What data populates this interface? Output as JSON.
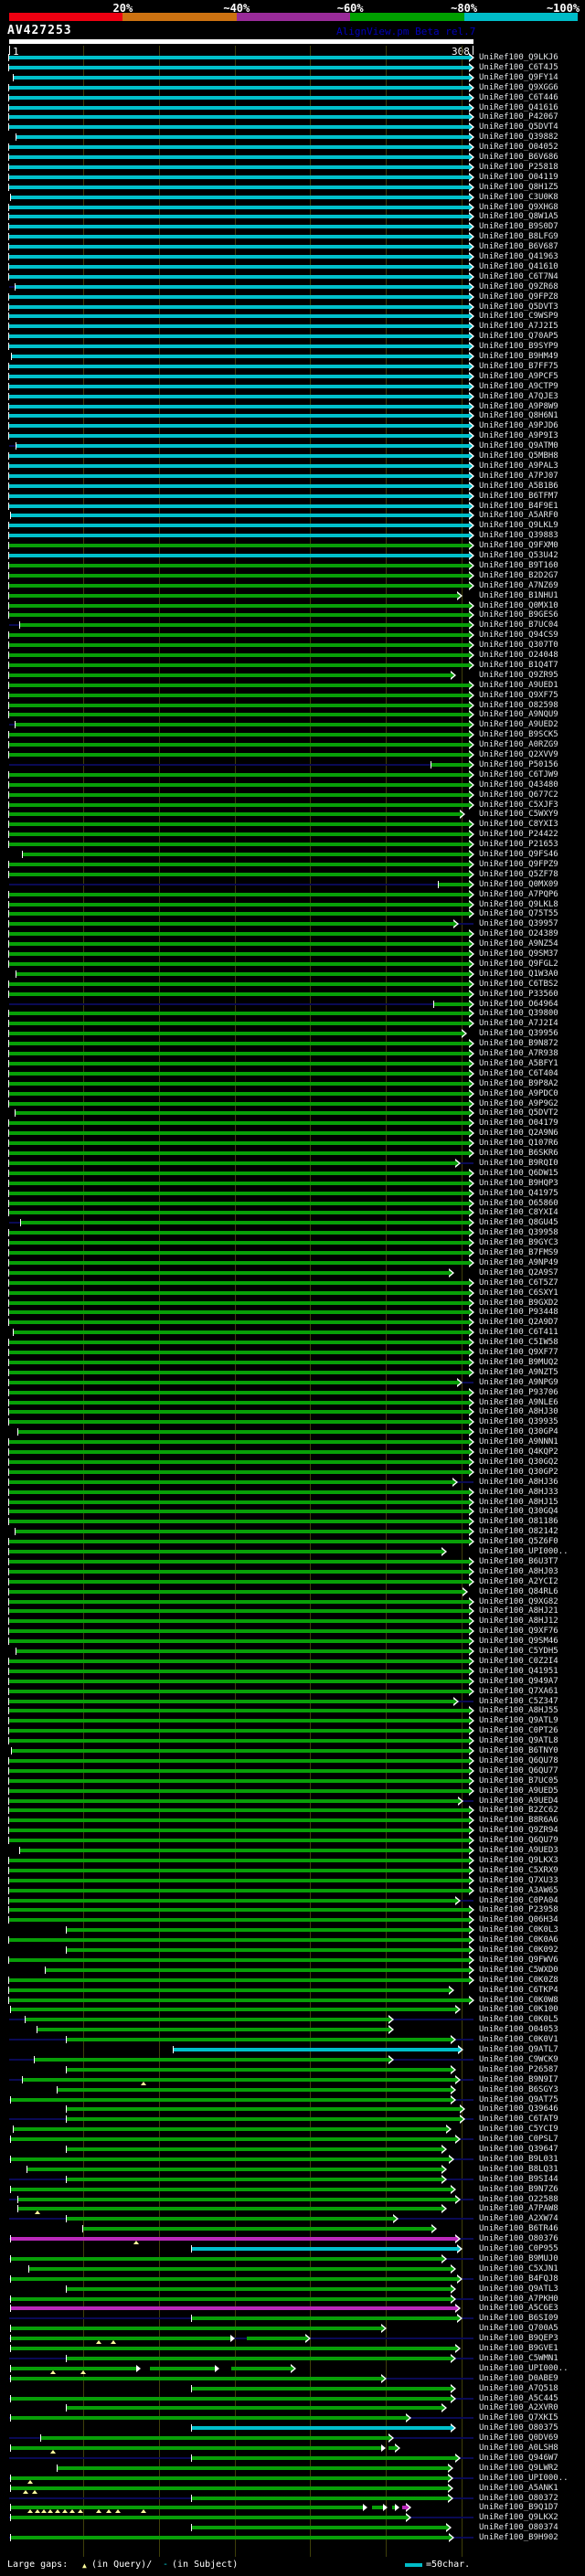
{
  "header": {
    "query_name": "AV427253",
    "tool_title": "AlignView.pm Beta rel.7"
  },
  "identity_key": {
    "labels": [
      "20%",
      "~40%",
      "~60%",
      "~80%",
      "~100%"
    ],
    "colors": [
      "#ee0011",
      "#cc7211",
      "#992b99",
      "#00a000",
      "#00bcc8"
    ]
  },
  "scale": {
    "start_label": "1",
    "end_label": "308",
    "query_length": 308,
    "tick_interval": 50
  },
  "colors": {
    "background": "#000000",
    "bar_cyan": "#00c0cb",
    "bar_green": "#089f08",
    "bar_magenta": "#bb29bb",
    "baseline_navy": "#0a0a55",
    "grid": "#3f3f0a",
    "gap_marker": "#ffff9c",
    "label_text": "#e2e6e9",
    "query_bar": "#ffffff",
    "tool_title_text": "#0000bb"
  },
  "legend": {
    "large_gaps_label": "Large gaps:",
    "in_query_label": "(in Query)/",
    "subject_dash": "-",
    "in_subject_label": " (in Subject)",
    "scale_note": "=50char."
  },
  "hit_prefix": "UniRef100_",
  "rows": [
    [
      "Q9LKJ6",
      "c",
      0
    ],
    [
      "C6T4J5",
      "c",
      0
    ],
    [
      "Q9FY14",
      "c",
      [
        [
          4,
          308
        ]
      ]
    ],
    [
      "Q9XGG6",
      "c",
      0
    ],
    [
      "C6T446",
      "c",
      0
    ],
    [
      "Q41616",
      "c",
      0
    ],
    [
      "P42067",
      "c",
      0
    ],
    [
      "Q5DVT4",
      "c",
      0
    ],
    [
      "Q39882",
      "c",
      [
        [
          6,
          308
        ]
      ]
    ],
    [
      "O04052",
      "c",
      0
    ],
    [
      "B6V686",
      "c",
      0
    ],
    [
      "P25818",
      "c",
      0
    ],
    [
      "O04119",
      "c",
      0
    ],
    [
      "Q8H1Z5",
      "c",
      0
    ],
    [
      "C3U0K8",
      "c",
      [
        [
          2,
          308
        ]
      ]
    ],
    [
      "Q9XHG8",
      "c",
      0
    ],
    [
      "Q8W1A5",
      "c",
      0
    ],
    [
      "B9S0D7",
      "c",
      0
    ],
    [
      "B8LFG9",
      "c",
      0
    ],
    [
      "B6V687",
      "c",
      0
    ],
    [
      "Q41963",
      "c",
      0
    ],
    [
      "Q41610",
      "c",
      0
    ],
    [
      "C6T7N4",
      "c",
      0
    ],
    [
      "Q9ZR68",
      "c",
      [
        [
          5,
          308
        ]
      ]
    ],
    [
      "Q9FPZ8",
      "c",
      0
    ],
    [
      "Q5DVT3",
      "c",
      0
    ],
    [
      "C9WSP9",
      "c",
      0
    ],
    [
      "A7J2I5",
      "c",
      0
    ],
    [
      "Q70AP5",
      "c",
      0
    ],
    [
      "B9SYP9",
      "c",
      0
    ],
    [
      "B9HM49",
      "c",
      [
        [
          3,
          308
        ]
      ]
    ],
    [
      "B7FF75",
      "c",
      0
    ],
    [
      "A9PCF5",
      "c",
      0
    ],
    [
      "A9CTP9",
      "c",
      0
    ],
    [
      "A7QJE3",
      "c",
      0
    ],
    [
      "A9P8W9",
      "c",
      0
    ],
    [
      "Q8H6N1",
      "c",
      0
    ],
    [
      "A9PJD6",
      "c",
      0
    ],
    [
      "A9P9I3",
      "c",
      0
    ],
    [
      "Q9ATM0",
      "c",
      [
        [
          6,
          308
        ]
      ]
    ],
    [
      "Q5MBH8",
      "c",
      0
    ],
    [
      "A9PAL3",
      "c",
      0
    ],
    [
      "A7PJ07",
      "c",
      0
    ],
    [
      "A5B1B6",
      "c",
      0
    ],
    [
      "B6TFM7",
      "c",
      0
    ],
    [
      "B4F9E1",
      "c",
      0
    ],
    [
      "A5ARF0",
      "c",
      [
        [
          2,
          308
        ]
      ]
    ],
    [
      "Q9LKL9",
      "c",
      0
    ],
    [
      "Q39883",
      "c",
      0
    ],
    [
      "Q9FXM0",
      "g",
      0
    ],
    [
      "Q53U42",
      "c",
      0
    ],
    [
      "B9T160",
      "g",
      0
    ],
    [
      "B2D2G7",
      "g",
      0
    ],
    [
      "A7NZ69",
      "g",
      0
    ],
    [
      "B1NHU1",
      "g",
      [
        [
          1,
          300
        ]
      ]
    ],
    [
      "Q0MX10",
      "g",
      0
    ],
    [
      "B9GES6",
      "g",
      0
    ],
    [
      "B7UC04",
      "g",
      [
        [
          8,
          308
        ]
      ]
    ],
    [
      "Q94CS9",
      "g",
      0
    ],
    [
      "Q307T0",
      "g",
      0
    ],
    [
      "O24048",
      "g",
      0
    ],
    [
      "B1Q4T7",
      "g",
      0
    ],
    [
      "Q9ZR95",
      "g",
      [
        [
          1,
          296
        ]
      ]
    ],
    [
      "A9UED1",
      "g",
      0
    ],
    [
      "Q9XF75",
      "g",
      0
    ],
    [
      "O82598",
      "g",
      0
    ],
    [
      "A9NQU9",
      "g",
      0
    ],
    [
      "A9UED2",
      "g",
      [
        [
          5,
          308
        ]
      ]
    ],
    [
      "B9SCK5",
      "g",
      0
    ],
    [
      "A0RZG9",
      "g",
      0
    ],
    [
      "Q2XVV9",
      "g",
      0
    ],
    [
      "P50156",
      "g",
      [
        [
          280,
          308
        ]
      ]
    ],
    [
      "C6TJW9",
      "g",
      0
    ],
    [
      "Q43480",
      "g",
      0
    ],
    [
      "Q677C2",
      "g",
      0
    ],
    [
      "C5XJF3",
      "g",
      0
    ],
    [
      "C5WXY9",
      "g",
      [
        [
          1,
          302
        ]
      ]
    ],
    [
      "C8YXI3",
      "g",
      0
    ],
    [
      "P24422",
      "g",
      0
    ],
    [
      "P21653",
      "g",
      0
    ],
    [
      "Q9FS46",
      "g",
      [
        [
          10,
          308
        ]
      ]
    ],
    [
      "Q9FPZ9",
      "g",
      0
    ],
    [
      "Q5ZF78",
      "g",
      0
    ],
    [
      "Q0MX09",
      "g",
      [
        [
          285,
          308
        ]
      ]
    ],
    [
      "A7PQP6",
      "g",
      0
    ],
    [
      "Q9LKL8",
      "g",
      0
    ],
    [
      "Q75T55",
      "g",
      0
    ],
    [
      "Q39957",
      "g",
      [
        [
          1,
          298
        ]
      ]
    ],
    [
      "O24389",
      "g",
      0
    ],
    [
      "A9NZ54",
      "g",
      0
    ],
    [
      "Q9SM37",
      "g",
      0
    ],
    [
      "Q9FGL2",
      "g",
      0
    ],
    [
      "Q1W3A0",
      "g",
      [
        [
          6,
          308
        ]
      ]
    ],
    [
      "C6TBS2",
      "g",
      0
    ],
    [
      "P33560",
      "g",
      0
    ],
    [
      "O64964",
      "g",
      [
        [
          282,
          308
        ]
      ]
    ],
    [
      "Q39800",
      "g",
      0
    ],
    [
      "A7J2I4",
      "g",
      0
    ],
    [
      "Q39956",
      "g",
      [
        [
          1,
          303
        ]
      ]
    ],
    [
      "B9N872",
      "g",
      0
    ],
    [
      "A7R938",
      "g",
      0
    ],
    [
      "A5BFY1",
      "g",
      0
    ],
    [
      "C6T404",
      "g",
      0
    ],
    [
      "B9P8A2",
      "g",
      0
    ],
    [
      "A9PDC0",
      "g",
      0
    ],
    [
      "A9P9G2",
      "g",
      0
    ],
    [
      "Q5DVT2",
      "g",
      [
        [
          5,
          308
        ]
      ]
    ],
    [
      "O04179",
      "g",
      0
    ],
    [
      "Q2A9N6",
      "g",
      0
    ],
    [
      "Q107R6",
      "g",
      0
    ],
    [
      "B6SKR6",
      "g",
      0
    ],
    [
      "B9RQI0",
      "g",
      [
        [
          1,
          299
        ]
      ]
    ],
    [
      "Q6DW15",
      "g",
      0
    ],
    [
      "B9HQP3",
      "g",
      0
    ],
    [
      "Q41975",
      "g",
      0
    ],
    [
      "O65860",
      "g",
      0
    ],
    [
      "C8YXI4",
      "g",
      0
    ],
    [
      "Q8GU45",
      "g",
      [
        [
          9,
          308
        ]
      ]
    ],
    [
      "Q39958",
      "g",
      0
    ],
    [
      "B9GYC3",
      "g",
      0
    ],
    [
      "B7FMS9",
      "g",
      0
    ],
    [
      "A9NP49",
      "g",
      0
    ],
    [
      "Q2A9S7",
      "g",
      [
        [
          1,
          295
        ]
      ]
    ],
    [
      "C6T5Z7",
      "g",
      0
    ],
    [
      "C6SXY1",
      "g",
      0
    ],
    [
      "B9GXD2",
      "g",
      0
    ],
    [
      "P93448",
      "g",
      0
    ],
    [
      "Q2A9D7",
      "g",
      0
    ],
    [
      "C6T411",
      "g",
      [
        [
          4,
          308
        ]
      ]
    ],
    [
      "C5IW58",
      "g",
      0
    ],
    [
      "Q9XF77",
      "g",
      0
    ],
    [
      "B9MUQ2",
      "g",
      0
    ],
    [
      "A9NZT5",
      "g",
      0
    ],
    [
      "A9NPG9",
      "g",
      [
        [
          1,
          300
        ]
      ]
    ],
    [
      "P93706",
      "g",
      0
    ],
    [
      "A9NLE6",
      "g",
      0
    ],
    [
      "A8HJ30",
      "g",
      0
    ],
    [
      "Q39935",
      "g",
      0
    ],
    [
      "Q30GP4",
      "g",
      [
        [
          7,
          308
        ]
      ]
    ],
    [
      "A9NNN1",
      "g",
      0
    ],
    [
      "Q4KQP2",
      "g",
      0
    ],
    [
      "Q30GQ2",
      "g",
      0
    ],
    [
      "Q30GP2",
      "g",
      0
    ],
    [
      "A8HJ36",
      "g",
      [
        [
          1,
          297
        ]
      ]
    ],
    [
      "A8HJ33",
      "g",
      0
    ],
    [
      "A8HJ15",
      "g",
      0
    ],
    [
      "Q30GQ4",
      "g",
      0
    ],
    [
      "O81186",
      "g",
      0
    ],
    [
      "O82142",
      "g",
      [
        [
          5,
          308
        ]
      ]
    ],
    [
      "Q5Z6F0",
      "g",
      0
    ],
    [
      "UPI000..",
      "g",
      [
        [
          1,
          290
        ]
      ]
    ],
    [
      "B6U3T7",
      "g",
      0
    ],
    [
      "A8HJ03",
      "g",
      0
    ],
    [
      "A2YCI2",
      "g",
      0
    ],
    [
      "Q84RL6",
      "g",
      [
        [
          1,
          304
        ]
      ]
    ],
    [
      "Q9XG82",
      "g",
      0
    ],
    [
      "A8HJ21",
      "g",
      0
    ],
    [
      "A8HJ12",
      "g",
      0
    ],
    [
      "Q9XF76",
      "g",
      0
    ],
    [
      "Q9SM46",
      "g",
      0
    ],
    [
      "C5YDH5",
      "g",
      [
        [
          6,
          308
        ]
      ]
    ],
    [
      "C0Z2I4",
      "g",
      0
    ],
    [
      "Q41951",
      "g",
      0
    ],
    [
      "Q949A7",
      "g",
      0
    ],
    [
      "Q7XA61",
      "g",
      0
    ],
    [
      "C5Z347",
      "g",
      [
        [
          1,
          298
        ]
      ]
    ],
    [
      "A8HJ55",
      "g",
      0
    ],
    [
      "Q9ATL9",
      "g",
      0
    ],
    [
      "C0PT26",
      "g",
      0
    ],
    [
      "Q9ATL8",
      "g",
      0
    ],
    [
      "B6TNY0",
      "g",
      [
        [
          3,
          308
        ]
      ]
    ],
    [
      "Q6QU78",
      "g",
      0
    ],
    [
      "Q6QU77",
      "g",
      0
    ],
    [
      "B7UC05",
      "g",
      0
    ],
    [
      "A9UED5",
      "g",
      0
    ],
    [
      "A9UED4",
      "g",
      [
        [
          1,
          301
        ]
      ]
    ],
    [
      "B2ZC62",
      "g",
      0
    ],
    [
      "B8R6A6",
      "g",
      0
    ],
    [
      "Q9ZR94",
      "g",
      0
    ],
    [
      "Q6QU79",
      "g",
      0
    ],
    [
      "A9UED3",
      "g",
      [
        [
          8,
          308
        ]
      ]
    ],
    [
      "Q9LKX3",
      "g",
      0
    ],
    [
      "C5XRX9",
      "g",
      0
    ],
    [
      "Q7XU33",
      "g",
      0
    ],
    [
      "A3AW65",
      "g",
      0
    ],
    [
      "C0PA04",
      "g",
      [
        [
          1,
          299
        ]
      ]
    ],
    [
      "P23958",
      "g",
      0
    ],
    [
      "Q06H34",
      "g",
      0
    ],
    [
      "C0K0L3",
      "g",
      [
        [
          39,
          308
        ]
      ]
    ],
    [
      "C0K0A6",
      "g",
      0
    ],
    [
      "C0K092",
      "g",
      [
        [
          39,
          308
        ]
      ]
    ],
    [
      "Q9FWV6",
      "g",
      0
    ],
    [
      "C5WXD0",
      "g",
      [
        [
          25,
          308
        ]
      ]
    ],
    [
      "C0K0Z8",
      "g",
      0
    ],
    [
      "C6TKP4",
      "g",
      [
        [
          1,
          295
        ]
      ]
    ],
    [
      "C0K0W8",
      "g",
      0
    ],
    [
      "C0K100",
      "g",
      [
        [
          2,
          299
        ]
      ]
    ],
    [
      "C0K0L5",
      "g",
      [
        [
          12,
          255
        ]
      ]
    ],
    [
      "O04053",
      "g",
      [
        [
          20,
          255
        ]
      ]
    ],
    [
      "C0K0V1",
      "g",
      [
        [
          39,
          296
        ]
      ]
    ],
    [
      "Q9ATL7",
      "c",
      [
        [
          110,
          301
        ]
      ]
    ],
    [
      "C9WCK9",
      "g",
      [
        [
          18,
          255
        ]
      ]
    ],
    [
      "P26587",
      "g",
      [
        [
          39,
          296
        ]
      ]
    ],
    [
      "B9N9I7",
      "g",
      [
        [
          10,
          299
        ]
      ],
      [
        90
      ]
    ],
    [
      "B6SGY3",
      "g",
      [
        [
          33,
          296
        ]
      ]
    ],
    [
      "Q9AT75",
      "g",
      [
        [
          2,
          296
        ]
      ]
    ],
    [
      "Q39646",
      "g",
      [
        [
          39,
          302
        ]
      ]
    ],
    [
      "C6TAT9",
      "g",
      [
        [
          39,
          302
        ]
      ]
    ],
    [
      "C5YCI9",
      "g",
      [
        [
          4,
          293
        ]
      ]
    ],
    [
      "C0PSL7",
      "g",
      [
        [
          2,
          299
        ]
      ]
    ],
    [
      "Q39647",
      "g",
      [
        [
          39,
          290
        ]
      ]
    ],
    [
      "B9L031",
      "g",
      [
        [
          2,
          295
        ]
      ]
    ],
    [
      "B8LQ31",
      "g",
      [
        [
          13,
          290
        ]
      ]
    ],
    [
      "B9SI44",
      "g",
      [
        [
          39,
          290
        ]
      ]
    ],
    [
      "B9N7Z6",
      "g",
      [
        [
          2,
          296
        ]
      ]
    ],
    [
      "O22588",
      "g",
      [
        [
          7,
          299
        ]
      ]
    ],
    [
      "A7PAW8",
      "g",
      [
        [
          7,
          290
        ]
      ],
      [
        20
      ]
    ],
    [
      "A2XW74",
      "g",
      [
        [
          39,
          258
        ]
      ]
    ],
    [
      "B6TR46",
      "g",
      [
        [
          50,
          283
        ]
      ]
    ],
    [
      "O80376",
      "m",
      [
        [
          2,
          299
        ]
      ],
      [
        85
      ]
    ],
    [
      "C0P955",
      "c",
      [
        [
          122,
          300
        ]
      ]
    ],
    [
      "B9MUJ0",
      "g",
      [
        [
          2,
          290
        ]
      ]
    ],
    [
      "C5XJN1",
      "g",
      [
        [
          14,
          296
        ]
      ]
    ],
    [
      "B4FQJ8",
      "g",
      [
        [
          2,
          300
        ]
      ]
    ],
    [
      "Q9ATL3",
      "g",
      [
        [
          39,
          296
        ]
      ]
    ],
    [
      "A7PKH0",
      "g",
      [
        [
          2,
          296
        ]
      ]
    ],
    [
      "A5C6E3",
      "m",
      [
        [
          2,
          299
        ]
      ]
    ],
    [
      "B6SI09",
      "g",
      [
        [
          122,
          300
        ]
      ]
    ],
    [
      "Q700A5",
      "g",
      [
        [
          2,
          250
        ]
      ]
    ],
    [
      "B9QEP3",
      "g",
      [
        [
          2,
          150
        ],
        [
          158,
          200
        ]
      ],
      [
        60,
        70
      ]
    ],
    [
      "B9GVE1",
      "g",
      [
        [
          2,
          299
        ]
      ]
    ],
    [
      "C5WMN1",
      "g",
      [
        [
          39,
          296
        ]
      ]
    ],
    [
      "UPI000..",
      "g",
      [
        [
          2,
          88
        ],
        [
          94,
          140
        ],
        [
          148,
          190
        ]
      ],
      [
        30,
        50
      ]
    ],
    [
      "D0ABE9",
      "g",
      [
        [
          2,
          250
        ]
      ]
    ],
    [
      "A7Q518",
      "g",
      [
        [
          122,
          296
        ]
      ]
    ],
    [
      "A5C445",
      "g",
      [
        [
          2,
          296
        ]
      ]
    ],
    [
      "A2XVR0",
      "g",
      [
        [
          39,
          290
        ]
      ]
    ],
    [
      "Q7XKI5",
      "g",
      [
        [
          2,
          266
        ]
      ]
    ],
    [
      "O80375",
      "c",
      [
        [
          122,
          296
        ]
      ]
    ],
    [
      "Q0DV69",
      "g",
      [
        [
          22,
          255
        ]
      ]
    ],
    [
      "A0LSH8",
      "g",
      [
        [
          2,
          250
        ],
        [
          252,
          259
        ]
      ],
      [
        30
      ]
    ],
    [
      "Q946W7",
      "g",
      [
        [
          122,
          299
        ]
      ]
    ],
    [
      "Q9LWR2",
      "g",
      [
        [
          33,
          294
        ]
      ]
    ],
    [
      "UPI000..",
      "g",
      [
        [
          2,
          294
        ]
      ],
      [
        15
      ]
    ],
    [
      "A5ANK1",
      "g",
      [
        [
          2,
          294
        ]
      ],
      [
        12,
        18
      ]
    ],
    [
      "O80372",
      "g",
      [
        [
          122,
          294
        ]
      ]
    ],
    [
      "B9Q1D7",
      "g",
      [
        [
          2,
          238
        ],
        [
          241,
          251
        ],
        [
          254,
          259
        ],
        [
          261,
          266,
          "m"
        ]
      ],
      [
        15,
        20,
        24,
        28,
        33,
        38,
        43,
        48,
        60,
        67,
        73,
        90
      ]
    ],
    [
      "Q9LKX2",
      "g",
      [
        [
          2,
          266
        ]
      ]
    ],
    [
      "O80374",
      "g",
      [
        [
          122,
          293
        ]
      ]
    ],
    [
      "B9H902",
      "g",
      [
        [
          2,
          295
        ]
      ]
    ]
  ]
}
